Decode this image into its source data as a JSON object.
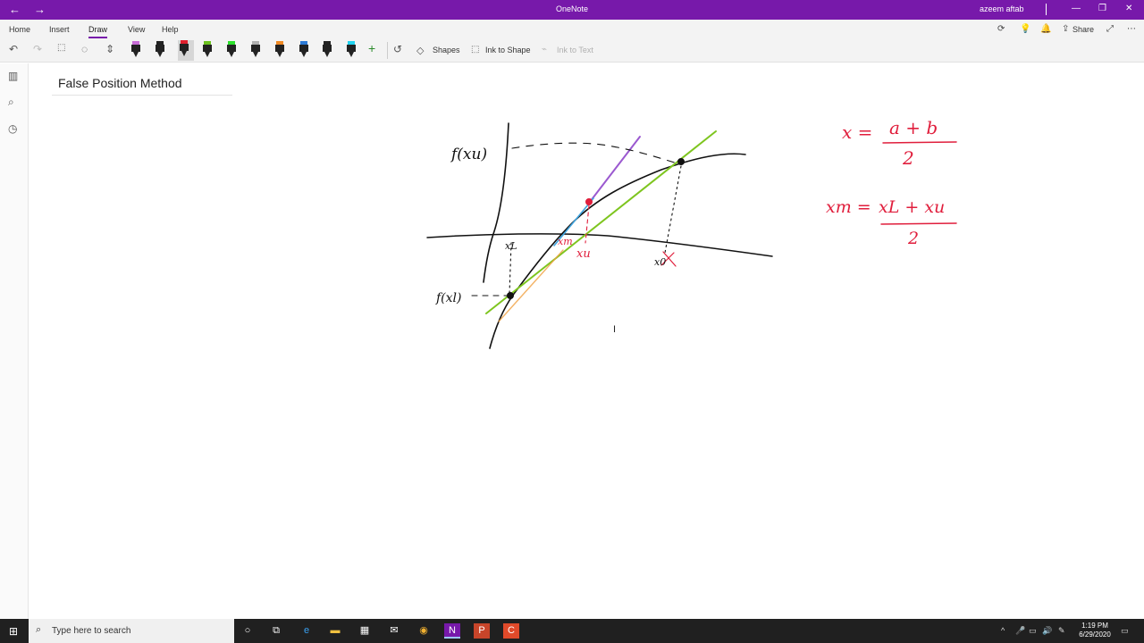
{
  "window": {
    "app_title": "OneNote",
    "user_name": "azeem aftab",
    "back_icon": "←",
    "forward_icon": "→",
    "minimize_icon": "—",
    "restore_icon": "❐",
    "close_icon": "✕"
  },
  "ribbon": {
    "tabs": [
      "Home",
      "Insert",
      "Draw",
      "View",
      "Help"
    ],
    "active_tab": "Draw",
    "share_label": "Share",
    "accent_color": "#7719aa"
  },
  "toolbar": {
    "shapes_label": "Shapes",
    "ink_to_shape_label": "Ink to Shape",
    "ink_to_text_label": "Ink to Text",
    "pens": [
      {
        "name": "pen-purple-highlighter",
        "cap": "#c86dd7"
      },
      {
        "name": "pen-black-1",
        "cap": "#222222"
      },
      {
        "name": "pen-red",
        "cap": "#e0202e"
      },
      {
        "name": "pen-green",
        "cap": "#6cc21f"
      },
      {
        "name": "pen-green-highlighter",
        "cap": "#2ce02c"
      },
      {
        "name": "pen-gray",
        "cap": "#b0b0b0"
      },
      {
        "name": "pen-orange",
        "cap": "#f08a24"
      },
      {
        "name": "pen-blue",
        "cap": "#2d7bd6"
      },
      {
        "name": "pen-black-2",
        "cap": "#222222"
      },
      {
        "name": "pen-cyan-highlighter",
        "cap": "#22d3f0"
      }
    ]
  },
  "page": {
    "title": "False Position Method"
  },
  "ink": {
    "f_xu": "f(xu)",
    "f_xl": "f(xl)",
    "x_l": "xL",
    "x_m_short": "xm",
    "x_u": "xu",
    "x_0": "x0",
    "eq1_lhs": "x =",
    "eq1_num": "a + b",
    "eq1_den": "2",
    "eq2_lhs": "xm =",
    "eq2_num": "xL + xu",
    "eq2_den": "2",
    "ink_red": "#e01e3c",
    "ink_green": "#7ec51f",
    "ink_black": "#111111"
  },
  "taskbar": {
    "search_placeholder": "Type here to search",
    "time": "1:19 PM",
    "date": "6/29/2020"
  }
}
